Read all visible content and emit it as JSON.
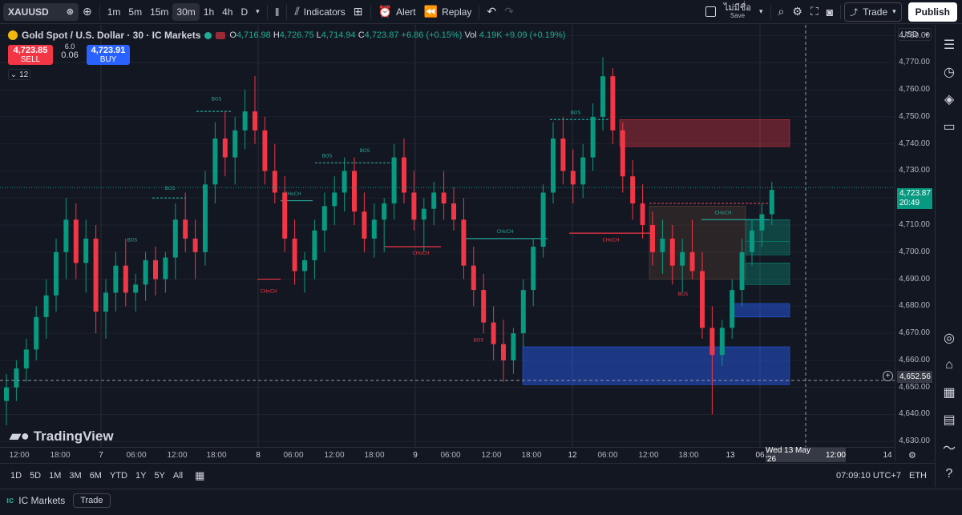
{
  "toolbar": {
    "symbol": "XAUUSD",
    "intervals": [
      "1m",
      "5m",
      "15m",
      "30m",
      "1h",
      "4h",
      "D"
    ],
    "active_interval": "30m",
    "indicators_label": "Indicators",
    "alert_label": "Alert",
    "replay_label": "Replay",
    "save_title": "ไม่มีชื่อ",
    "save_label": "Save",
    "trade_label": "Trade",
    "publish_label": "Publish"
  },
  "legend": {
    "title": "Gold Spot / U.S. Dollar · 30 · IC Markets",
    "o": "O",
    "o_val": "4,716.98",
    "h": "H",
    "h_val": "4,726.75",
    "l": "L",
    "l_val": "4,714.94",
    "c": "C",
    "c_val": "4,723.87",
    "change": "+6.86 (+0.15%)",
    "vol_label": "Vol",
    "vol_val": "4.19K",
    "vol_change": "+9.09 (+0.19%)"
  },
  "orderpanel": {
    "sell_price": "4,723.85",
    "sell_label": "SELL",
    "buy_price": "4,723.91",
    "buy_label": "BUY",
    "spread_top": "6.0",
    "spread": "0.06",
    "collapse_count": "12"
  },
  "watermark": "TradingView",
  "yaxis": {
    "currency": "USD",
    "ticks": [
      "4,780.00",
      "4,770.00",
      "4,760.00",
      "4,750.00",
      "4,740.00",
      "4,730.00",
      "4,720.00",
      "4,710.00",
      "4,700.00",
      "4,690.00",
      "4,680.00",
      "4,670.00",
      "4,660.00",
      "4,650.00",
      "4,640.00",
      "4,630.00"
    ],
    "last_price": "4,723.87",
    "countdown": "20:49",
    "cross_price": "4,652.56"
  },
  "xaxis": {
    "ticks": [
      "12:00",
      "18:00",
      "7",
      "06:00",
      "12:00",
      "18:00",
      "8",
      "06:00",
      "12:00",
      "18:00",
      "9",
      "06:00",
      "12:00",
      "18:00",
      "12",
      "06:00",
      "12:00",
      "18:00",
      "13",
      "06",
      "12:00",
      "14"
    ],
    "crosshair_date": "Wed 13 May '26",
    "crosshair_time": "12:00"
  },
  "bottombar": {
    "ranges": [
      "1D",
      "5D",
      "1M",
      "3M",
      "6M",
      "YTD",
      "1Y",
      "5Y",
      "All"
    ],
    "clock": "07:09:10 UTC+7",
    "session": "ETH"
  },
  "footer": {
    "broker": "IC Markets",
    "trade_label": "Trade"
  },
  "annotations": {
    "bos": "BOS",
    "choch": "CHoCH"
  },
  "chart_data": {
    "type": "candlestick",
    "symbol": "XAUUSD",
    "timeframe": "30",
    "ylim": [
      4628,
      4784
    ],
    "candles": [
      [
        4645,
        4655,
        4636,
        4650
      ],
      [
        4650,
        4660,
        4645,
        4657
      ],
      [
        4657,
        4668,
        4652,
        4664
      ],
      [
        4664,
        4680,
        4660,
        4676
      ],
      [
        4676,
        4690,
        4668,
        4684
      ],
      [
        4684,
        4705,
        4678,
        4700
      ],
      [
        4700,
        4720,
        4690,
        4712
      ],
      [
        4712,
        4718,
        4690,
        4696
      ],
      [
        4696,
        4712,
        4685,
        4705
      ],
      [
        4705,
        4710,
        4670,
        4678
      ],
      [
        4678,
        4690,
        4668,
        4685
      ],
      [
        4685,
        4700,
        4678,
        4695
      ],
      [
        4695,
        4705,
        4680,
        4685
      ],
      [
        4685,
        4692,
        4678,
        4688
      ],
      [
        4688,
        4700,
        4682,
        4697
      ],
      [
        4697,
        4702,
        4684,
        4690
      ],
      [
        4690,
        4700,
        4685,
        4698
      ],
      [
        4698,
        4718,
        4690,
        4712
      ],
      [
        4712,
        4722,
        4700,
        4705
      ],
      [
        4705,
        4712,
        4690,
        4700
      ],
      [
        4700,
        4730,
        4695,
        4725
      ],
      [
        4725,
        4748,
        4718,
        4742
      ],
      [
        4742,
        4752,
        4728,
        4735
      ],
      [
        4735,
        4750,
        4725,
        4745
      ],
      [
        4745,
        4760,
        4738,
        4752
      ],
      [
        4752,
        4765,
        4740,
        4745
      ],
      [
        4745,
        4750,
        4725,
        4730
      ],
      [
        4730,
        4740,
        4718,
        4722
      ],
      [
        4722,
        4728,
        4700,
        4705
      ],
      [
        4705,
        4712,
        4688,
        4693
      ],
      [
        4693,
        4700,
        4685,
        4697
      ],
      [
        4697,
        4712,
        4690,
        4708
      ],
      [
        4708,
        4722,
        4700,
        4717
      ],
      [
        4717,
        4728,
        4710,
        4722
      ],
      [
        4722,
        4735,
        4715,
        4730
      ],
      [
        4730,
        4735,
        4710,
        4715
      ],
      [
        4715,
        4722,
        4700,
        4705
      ],
      [
        4705,
        4718,
        4698,
        4712
      ],
      [
        4712,
        4720,
        4700,
        4718
      ],
      [
        4718,
        4740,
        4712,
        4735
      ],
      [
        4735,
        4742,
        4718,
        4722
      ],
      [
        4722,
        4730,
        4708,
        4712
      ],
      [
        4712,
        4720,
        4700,
        4716
      ],
      [
        4716,
        4726,
        4710,
        4722
      ],
      [
        4722,
        4730,
        4712,
        4718
      ],
      [
        4718,
        4724,
        4708,
        4712
      ],
      [
        4712,
        4720,
        4690,
        4695
      ],
      [
        4695,
        4702,
        4680,
        4686
      ],
      [
        4686,
        4692,
        4670,
        4674
      ],
      [
        4674,
        4680,
        4660,
        4666
      ],
      [
        4666,
        4675,
        4652,
        4660
      ],
      [
        4660,
        4672,
        4655,
        4670
      ],
      [
        4670,
        4690,
        4665,
        4686
      ],
      [
        4686,
        4705,
        4680,
        4702
      ],
      [
        4702,
        4725,
        4698,
        4722
      ],
      [
        4722,
        4748,
        4718,
        4742
      ],
      [
        4742,
        4750,
        4725,
        4730
      ],
      [
        4730,
        4738,
        4718,
        4725
      ],
      [
        4725,
        4740,
        4720,
        4735
      ],
      [
        4735,
        4755,
        4730,
        4750
      ],
      [
        4750,
        4772,
        4745,
        4765
      ],
      [
        4765,
        4768,
        4740,
        4745
      ],
      [
        4745,
        4748,
        4722,
        4728
      ],
      [
        4728,
        4734,
        4712,
        4718
      ],
      [
        4718,
        4725,
        4705,
        4710
      ],
      [
        4710,
        4715,
        4695,
        4700
      ],
      [
        4700,
        4712,
        4692,
        4705
      ],
      [
        4705,
        4710,
        4688,
        4695
      ],
      [
        4695,
        4705,
        4685,
        4700
      ],
      [
        4700,
        4712,
        4690,
        4693
      ],
      [
        4693,
        4700,
        4668,
        4672
      ],
      [
        4672,
        4680,
        4640,
        4662
      ],
      [
        4662,
        4675,
        4658,
        4672
      ],
      [
        4672,
        4690,
        4668,
        4686
      ],
      [
        4686,
        4705,
        4680,
        4700
      ],
      [
        4700,
        4712,
        4695,
        4708
      ],
      [
        4708,
        4718,
        4702,
        4714
      ],
      [
        4714,
        4726,
        4710,
        4723
      ]
    ]
  }
}
